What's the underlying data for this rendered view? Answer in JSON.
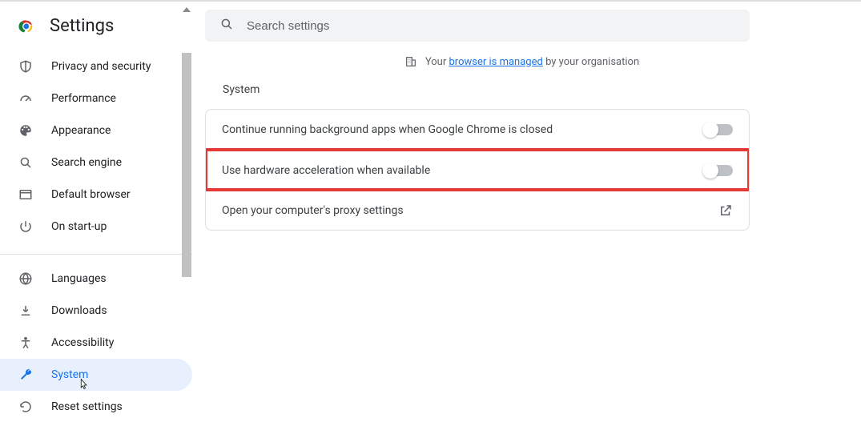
{
  "brand": {
    "title": "Settings"
  },
  "search": {
    "placeholder": "Search settings"
  },
  "managed": {
    "prefix": "Your",
    "link": "browser is managed",
    "suffix": "by your organisation"
  },
  "section": {
    "title": "System"
  },
  "rows": {
    "bg": "Continue running background apps when Google Chrome is closed",
    "hw": "Use hardware acceleration when available",
    "proxy": "Open your computer's proxy settings"
  },
  "nav": {
    "privacy": "Privacy and security",
    "performance": "Performance",
    "appearance": "Appearance",
    "search_engine": "Search engine",
    "default_browser": "Default browser",
    "on_startup": "On start-up",
    "languages": "Languages",
    "downloads": "Downloads",
    "accessibility": "Accessibility",
    "system": "System",
    "reset": "Reset settings"
  }
}
